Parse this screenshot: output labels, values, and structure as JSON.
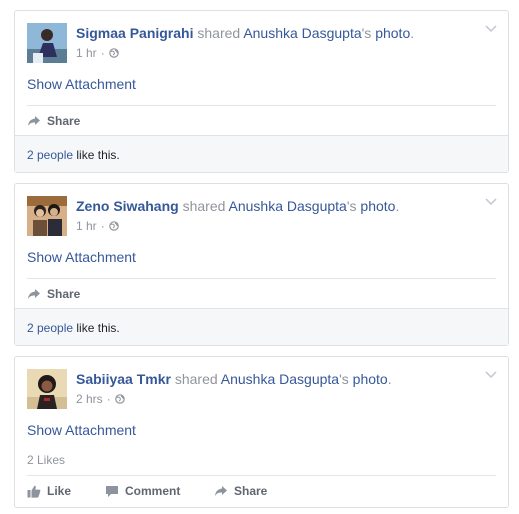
{
  "posts": [
    {
      "actor": "Sigmaa Panigrahi",
      "verb": "shared",
      "owner": "Anushka Dasgupta",
      "possessive": "'s",
      "object": "photo",
      "punct": ".",
      "time": "1 hr",
      "sep": "·",
      "attachment": "Show Attachment",
      "share_label": "Share",
      "likes_people": "2 people",
      "likes_suffix": "like this."
    },
    {
      "actor": "Zeno Siwahang",
      "verb": "shared",
      "owner": "Anushka Dasgupta",
      "possessive": "'s",
      "object": "photo",
      "punct": ".",
      "time": "1 hr",
      "sep": "·",
      "attachment": "Show Attachment",
      "share_label": "Share",
      "likes_people": "2 people",
      "likes_suffix": "like this."
    },
    {
      "actor": "Sabiiyaa Tmkr",
      "verb": "shared",
      "owner": "Anushka Dasgupta",
      "possessive": "'s",
      "object": "photo",
      "punct": ".",
      "time": "2 hrs",
      "sep": "·",
      "attachment": "Show Attachment",
      "likes_count": "2 Likes",
      "like_label": "Like",
      "comment_label": "Comment",
      "share_label": "Share"
    }
  ],
  "colors": {
    "link": "#365899",
    "meta": "#90949c",
    "action": "#606770",
    "border": "#dddfe2",
    "footer_bg": "#f6f7f9"
  }
}
